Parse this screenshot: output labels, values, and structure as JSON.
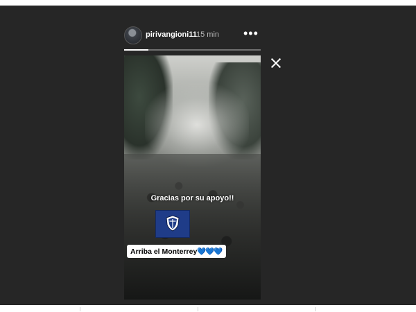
{
  "header": {
    "username": "pirivangioni11",
    "time": "15 min",
    "more_label": "•••"
  },
  "story": {
    "progress_fraction": 0.18,
    "caption_primary": "Gracias por su apoyo!!",
    "caption_secondary": "Arriba el Monterrey",
    "caption_secondary_hearts": "💙💙💙"
  },
  "colors": {
    "background": "#262626",
    "flag_blue": "#1f3c88",
    "heart_blue": "#3a9ae8"
  },
  "icons": [
    "avatar",
    "more-options-icon",
    "close-icon",
    "monterrey-crest-icon"
  ]
}
